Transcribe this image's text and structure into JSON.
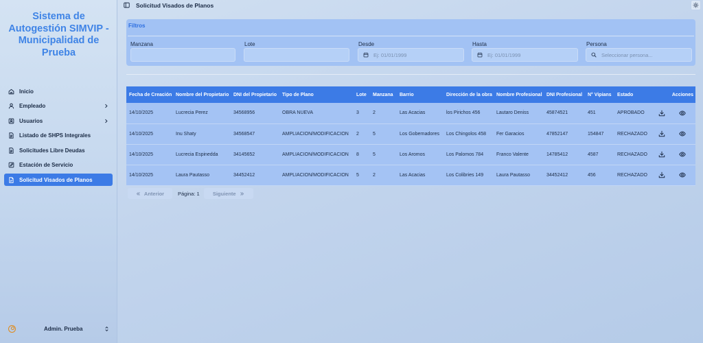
{
  "sidebar": {
    "brand_lines": [
      "Sistema de",
      "Autogestión SIMVIP -",
      "Municipalidad de",
      "Prueba"
    ],
    "items": [
      {
        "label": "Inicio",
        "icon": "home-icon",
        "active": false,
        "has_children": false
      },
      {
        "label": "Empleado",
        "icon": "user-icon",
        "active": false,
        "has_children": true
      },
      {
        "label": "Usuarios",
        "icon": "users-icon",
        "active": false,
        "has_children": true
      },
      {
        "label": "Listado de SHPS Integrales",
        "icon": "document-icon",
        "active": false,
        "has_children": false
      },
      {
        "label": "Solicitudes Libre Deudas",
        "icon": "document-icon",
        "active": false,
        "has_children": false
      },
      {
        "label": "Estación de Servicio",
        "icon": "edit-icon",
        "active": false,
        "has_children": false
      },
      {
        "label": "Solicitud Visados de Planos",
        "icon": "file-icon",
        "active": true,
        "has_children": false
      }
    ],
    "user_name": "Admin. Prueba"
  },
  "header": {
    "title": "Solicitud Visados de Planos"
  },
  "filters": {
    "title": "Filtros",
    "fields": {
      "manzana": {
        "label": "Manzana",
        "value": "",
        "placeholder": ""
      },
      "lote": {
        "label": "Lote",
        "value": "",
        "placeholder": ""
      },
      "desde": {
        "label": "Desde",
        "value": "",
        "placeholder": "Ej: 01/01/1999"
      },
      "hasta": {
        "label": "Hasta",
        "value": "",
        "placeholder": "Ej: 01/01/1999"
      },
      "persona": {
        "label": "Persona",
        "value": "",
        "placeholder": "Seleccionar persona..."
      }
    }
  },
  "table": {
    "columns": [
      "Fecha de Creación",
      "Nombre del Propietario",
      "DNI del Propietario",
      "Tipo de Plano",
      "Lote",
      "Manzana",
      "Barrio",
      "Dirección de la obra",
      "Nombre Profesional",
      "DNI Profesional",
      "N° Vipians",
      "Estado",
      "Acciones"
    ],
    "rows": [
      [
        "14/10/2025",
        "Lucrecia Perez",
        "34568956",
        "OBRA NUEVA",
        "3",
        "2",
        "Las Acacias",
        "los Pirichos 456",
        "Lautaro Deniss",
        "45874521",
        "451",
        "APROBADO"
      ],
      [
        "14/10/2025",
        "Inu Shaty",
        "34568547",
        "AMPLIACION/MODIFICACION",
        "2",
        "5",
        "Los Gobernadores",
        "Los Chingolos 458",
        "Fer Garacios",
        "47852147",
        "154847",
        "RECHAZADO"
      ],
      [
        "14/10/2025",
        "Lucrecia Espinedda",
        "34145652",
        "AMPLIACION/MODIFICACION",
        "8",
        "5",
        "Los Aromos",
        "Los Palomos 784",
        "Franco Valente",
        "14785412",
        "4587",
        "RECHAZADO"
      ],
      [
        "14/10/2025",
        "Laura Pautasso",
        "34452412",
        "AMPLIACION/MODIFICACION",
        "5",
        "2",
        "Las Acacias",
        "Los Colibries 149",
        "Laura Pautasso",
        "34452412",
        "456",
        "RECHAZADO"
      ]
    ],
    "row_action_icons": [
      "download-icon",
      "eye-icon"
    ]
  },
  "pagination": {
    "prev_label": "Anterior",
    "page_text": "Página: 1",
    "next_label": "Siguiente"
  },
  "colors": {
    "accent": "#3c7be6",
    "brand": "#3f84e6",
    "avatar": "#e08a1a"
  }
}
